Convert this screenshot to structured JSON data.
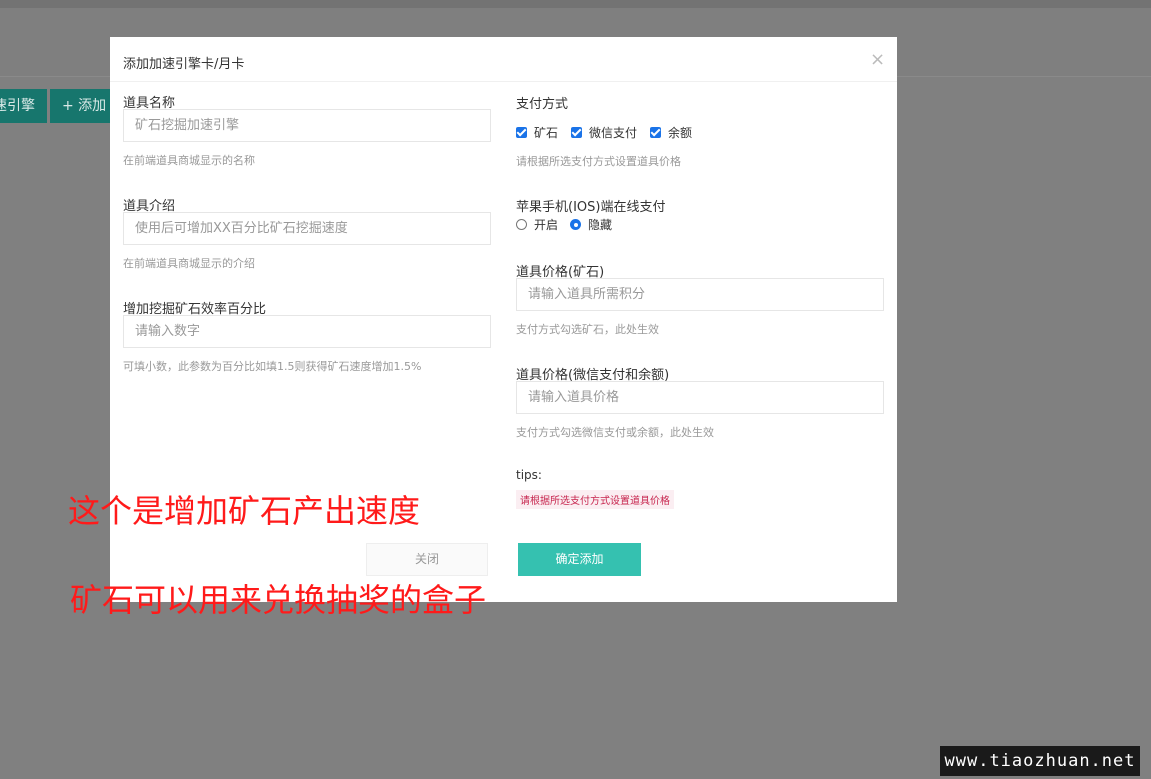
{
  "background": {
    "btn_speed": "速引擎",
    "btn_add": "+ 添加"
  },
  "modal": {
    "title": "添加加速引擎卡/月卡",
    "close_symbol": "×",
    "fields": {
      "name": {
        "label": "道具名称",
        "placeholder": "矿石挖掘加速引擎",
        "help": "在前端道具商城显示的名称"
      },
      "intro": {
        "label": "道具介绍",
        "placeholder": "使用后可增加XX百分比矿石挖掘速度",
        "help": "在前端道具商城显示的介绍"
      },
      "rate": {
        "label": "增加挖掘矿石效率百分比",
        "placeholder": "请输入数字",
        "help": "可填小数，此参数为百分比如填1.5则获得矿石速度增加1.5%"
      },
      "payment": {
        "label": "支付方式",
        "options": [
          "矿石",
          "微信支付",
          "余额"
        ],
        "help": "请根据所选支付方式设置道具价格"
      },
      "ios": {
        "label": "苹果手机(IOS)端在线支付",
        "options": [
          "开启",
          "隐藏"
        ],
        "selected": "隐藏"
      },
      "price_ore": {
        "label": "道具价格(矿石)",
        "placeholder": "请输入道具所需积分",
        "help": "支付方式勾选矿石，此处生效"
      },
      "price_money": {
        "label": "道具价格(微信支付和余额)",
        "placeholder": "请输入道具价格",
        "help": "支付方式勾选微信支付或余额，此处生效"
      }
    },
    "tips": {
      "label": "tips:",
      "text": "请根据所选支付方式设置道具价格"
    },
    "buttons": {
      "close": "关闭",
      "confirm": "确定添加"
    }
  },
  "annotations": {
    "line1": "这个是增加矿石产出速度",
    "line2": "矿石可以用来兑换抽奖的盒子"
  },
  "watermark": "www.tiaozhuan.net"
}
